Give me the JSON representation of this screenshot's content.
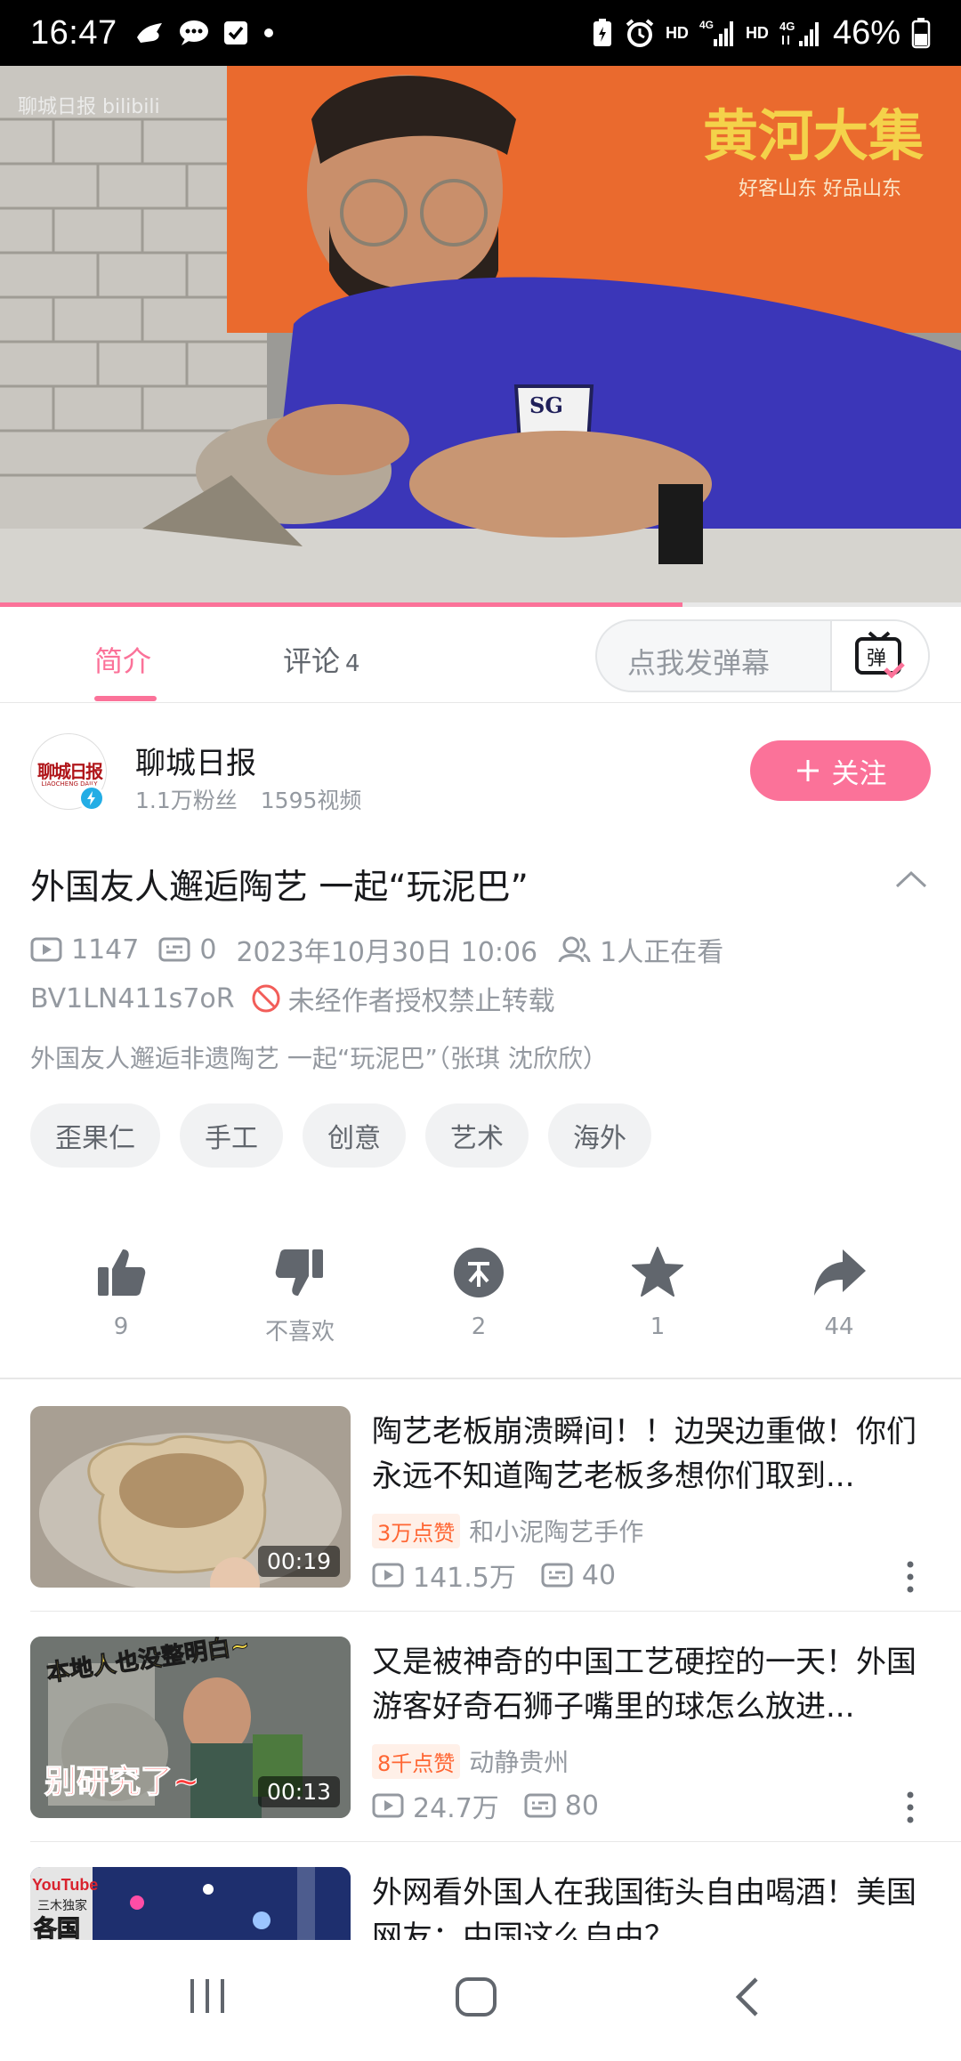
{
  "status_bar": {
    "time": "16:47",
    "battery": "46%",
    "labels": [
      "HD",
      "4G",
      "HD",
      "4G"
    ]
  },
  "video": {
    "watermark": "聊城日报 bilibili",
    "banner_text": "黄河大集",
    "banner_sub": "好客山东 好品山东",
    "progress": 0.71
  },
  "tabs": {
    "intro": "简介",
    "comments": "评论",
    "comments_count": "4",
    "danmaku_placeholder": "点我发弹幕"
  },
  "uploader": {
    "name": "聊城日报",
    "avatar_logo": "聊城日报",
    "avatar_sub": "LIAOCHENG DAILY",
    "fans": "1.1万粉丝",
    "videos": "1595视频",
    "follow_label": "关注"
  },
  "info": {
    "title": "外国友人邂逅陶艺  一起“玩泥巴”",
    "views": "1147",
    "danmaku": "0",
    "date": "2023年10月30日 10:06",
    "watching": "1人正在看",
    "bvid": "BV1LN411s7oR",
    "copyright": "未经作者授权禁止转载",
    "description": "外国友人邂逅非遗陶艺 一起“玩泥巴”（张琪 沈欣欣）",
    "tags": [
      "歪果仁",
      "手工",
      "创意",
      "艺术",
      "海外"
    ]
  },
  "actions": [
    {
      "name": "like",
      "label": "9"
    },
    {
      "name": "dislike",
      "label": "不喜欢"
    },
    {
      "name": "coin",
      "label": "2"
    },
    {
      "name": "favorite",
      "label": "1"
    },
    {
      "name": "share",
      "label": "44"
    }
  ],
  "recommendations": [
    {
      "title": "陶艺老板崩溃瞬间！！边哭边重做！你们永远不知道陶艺老板多想你们取到...",
      "duration": "00:19",
      "likes_badge": "3万点赞",
      "author": "和小泥陶艺手作",
      "views": "141.5万",
      "danmaku": "40"
    },
    {
      "title": "又是被神奇的中国工艺硬控的一天！外国游客好奇石狮子嘴里的球怎么放进...",
      "duration": "00:13",
      "likes_badge": "8千点赞",
      "author": "动静贵州",
      "views": "24.7万",
      "danmaku": "80",
      "thumb_text_top": "本地人也没整明白~",
      "thumb_text_bottom": "别研究了~"
    },
    {
      "title": "外网看外国人在我国街头自由喝酒！美国网友：中国这么自由？",
      "thumb_text_top": "YouTube",
      "thumb_text_mid": "三木独家",
      "thumb_text_bottom": "各国"
    }
  ]
}
